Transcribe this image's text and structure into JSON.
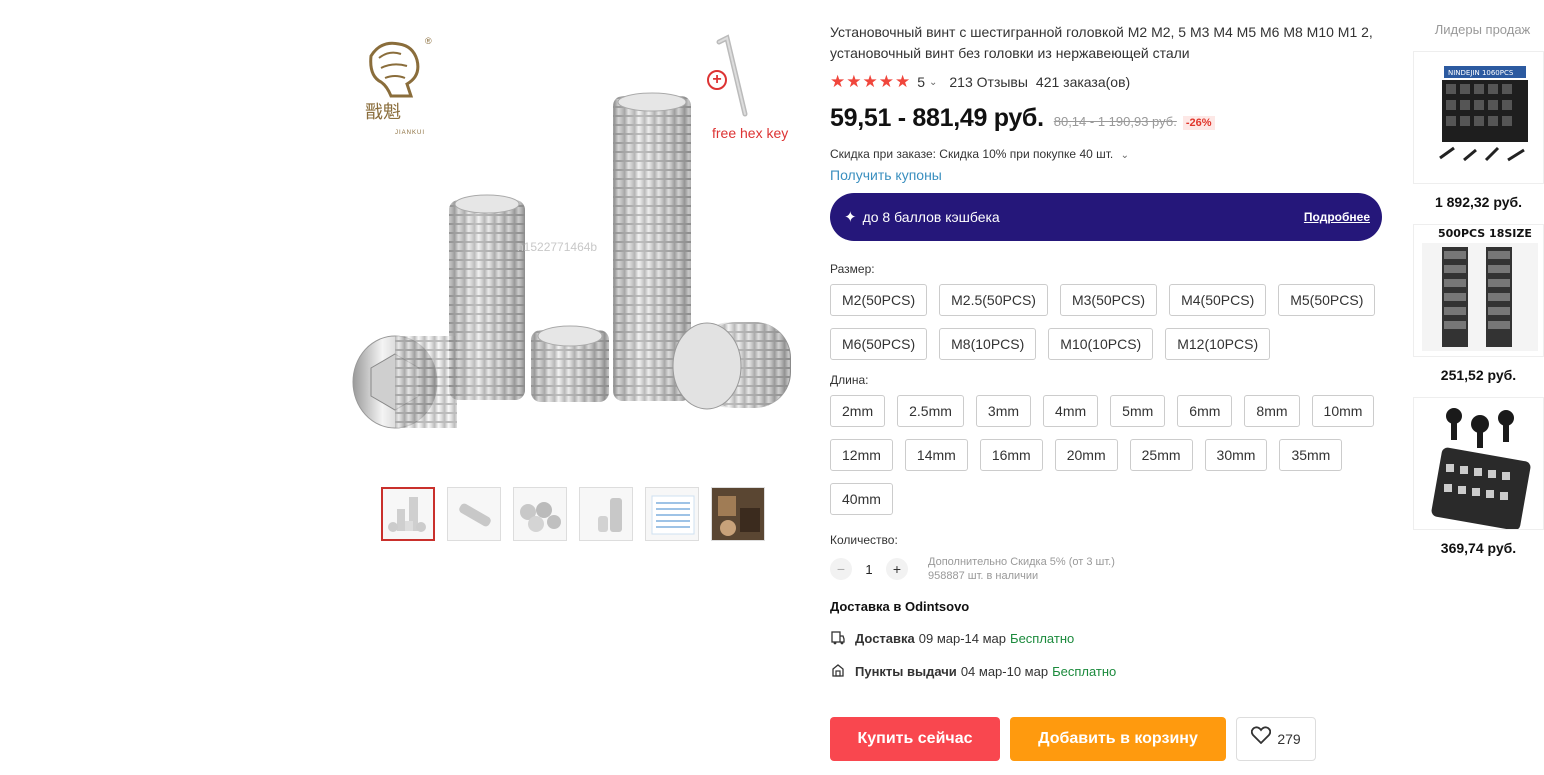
{
  "product": {
    "title": "Установочный винт с шестигранной головкой M2 M2, 5 M3 M4 M5 M6 M8 M10 M1 2, установочный винт без головки из нержавеющей стали",
    "rating": "5",
    "stars": "★★★★★",
    "reviews": "213 Отзывы",
    "orders": "421 заказа(ов)",
    "price": "59,51 - 881,49 руб.",
    "old_price": "80,14 - 1 190,93 руб.",
    "discount": "-26%",
    "order_discount": "Скидка при заказе: Скидка 10% при покупке 40 шт.",
    "coupons": "Получить купоны",
    "cashback_text": "до 8 баллов кэшбека",
    "cashback_more": "Подробнее"
  },
  "gallery": {
    "hex_key_label": "free hex key",
    "watermark": "n1522771464b",
    "brand_sub": "JIANKUI",
    "brand_reg": "®",
    "thumbnails": [
      "thumb-1",
      "thumb-2",
      "thumb-3",
      "thumb-4",
      "thumb-5",
      "thumb-6"
    ]
  },
  "size": {
    "label": "Размер:",
    "options": [
      "M2(50PCS)",
      "M2.5(50PCS)",
      "M3(50PCS)",
      "M4(50PCS)",
      "M5(50PCS)",
      "M6(50PCS)",
      "M8(10PCS)",
      "M10(10PCS)",
      "M12(10PCS)"
    ]
  },
  "length": {
    "label": "Длина:",
    "options": [
      "2mm",
      "2.5mm",
      "3mm",
      "4mm",
      "5mm",
      "6mm",
      "8mm",
      "10mm",
      "12mm",
      "14mm",
      "16mm",
      "20mm",
      "25mm",
      "30mm",
      "35mm",
      "40mm"
    ]
  },
  "quantity": {
    "label": "Количество:",
    "value": "1",
    "minus": "−",
    "plus": "+",
    "note1": "Дополнительно Скидка 5% (от 3 шт.)",
    "note2": "958887 шт. в наличии"
  },
  "delivery": {
    "title": "Доставка в Odintsovo",
    "courier_name": "Доставка",
    "courier_dates": "09 мар-14 мар",
    "courier_price": "Бесплатно",
    "pickup_name": "Пункты выдачи",
    "pickup_dates": "04 мар-10 мар",
    "pickup_price": "Бесплатно"
  },
  "actions": {
    "buy_now": "Купить сейчас",
    "add_to_cart": "Добавить в корзину",
    "wishlist_count": "279"
  },
  "bestsellers": {
    "title": "Лидеры продаж",
    "items": [
      {
        "price": "1 892,32 руб.",
        "img_text": "NINDEJIN 1060PCS"
      },
      {
        "price": "251,52 руб.",
        "img_text": "500PCS 18SIZE"
      },
      {
        "price": "369,74 руб.",
        "img_text": ""
      }
    ]
  },
  "colors": {
    "accent_red": "#f9474f",
    "accent_orange": "#ff9a0e",
    "cashback_bg": "#25177a",
    "link_blue": "#3a8fbf",
    "free_green": "#1b8a3c"
  }
}
